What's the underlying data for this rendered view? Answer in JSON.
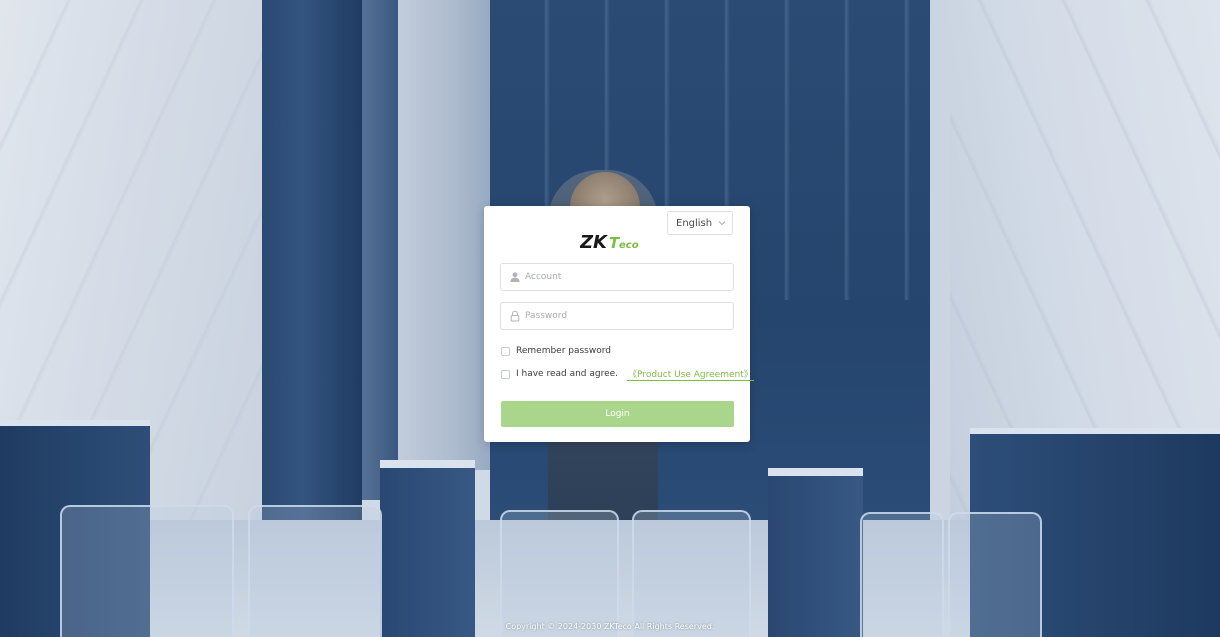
{
  "colors": {
    "brand_green": "#7bbf42",
    "login_button": "#a9d68a",
    "brand_dark": "#1a1a1a"
  },
  "language": {
    "selected": "English",
    "icon": "chevron-down-icon"
  },
  "logo": {
    "text_main": "ZK",
    "text_sub": "Teco"
  },
  "form": {
    "account_placeholder": "Account",
    "account_value": "",
    "account_icon": "user-icon",
    "password_placeholder": "Password",
    "password_value": "",
    "password_icon": "lock-icon",
    "remember_label": "Remember password",
    "agree_label": "I have read and agree.",
    "agreement_link": "《Product Use Agreement》",
    "login_label": "Login"
  },
  "footer": {
    "copyright": "Copyright © 2024-2030 ZKTeco All Rights Reserved."
  }
}
